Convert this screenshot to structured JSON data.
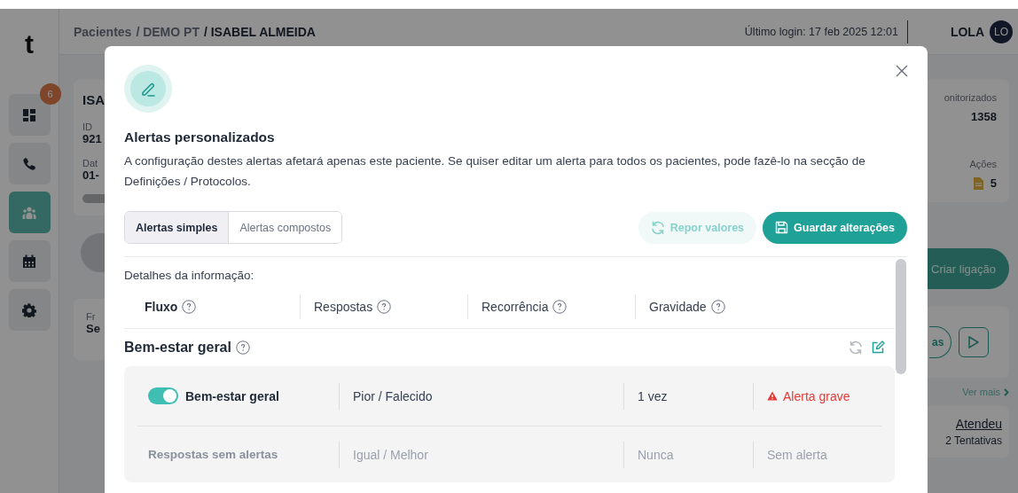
{
  "sidebar": {
    "logo": "t",
    "items": [
      {
        "kind": "dashboard",
        "badge": "6",
        "selected": false
      },
      {
        "kind": "phone",
        "selected": false
      },
      {
        "kind": "people",
        "selected": true
      },
      {
        "kind": "calendar",
        "selected": false
      },
      {
        "kind": "gear",
        "selected": false
      }
    ]
  },
  "header": {
    "breadcrumb": [
      {
        "label": "Pacientes",
        "current": false
      },
      {
        "label": "/ DEMO PT",
        "current": false
      },
      {
        "label": "/ ISABEL ALMEIDA",
        "current": true
      }
    ],
    "last_login": "Último login: 17 feb 2025 12:01",
    "user": "LOLA",
    "avatar": "LO"
  },
  "background": {
    "patient_card": {
      "name": "ISA",
      "fields": [
        {
          "label": "ID",
          "value": "921"
        },
        {
          "label": "Dat",
          "value": "01-"
        }
      ]
    },
    "frequency_card": {
      "label": "Fr",
      "value": "Se"
    },
    "stats_card": {
      "monitored_label": "onitorizados",
      "monitored_value": "1358",
      "actions_label": "Ações",
      "actions_value": "5"
    },
    "create_call_button": "Criar ligação",
    "call_card_button": "as",
    "see_more": "Ver mais",
    "call_result": {
      "status": "Atendeu",
      "attempts": "2 Tentativas"
    }
  },
  "modal": {
    "title": "Alertas personalizados",
    "description": "A configuração destes alertas afetará apenas este paciente. Se quiser editar um alerta para todos os pacientes, pode fazê-lo na secção de Definições / Protocolos.",
    "tabs": [
      {
        "label": "Alertas simples",
        "selected": true
      },
      {
        "label": "Alertas compostos",
        "selected": false
      }
    ],
    "reset_button": {
      "label": "Repor valores",
      "disabled": true
    },
    "save_button": "Guardar alterações",
    "details_label": "Detalhes da informação:",
    "columns": [
      {
        "label": "Fluxo",
        "emphasized": true
      },
      {
        "label": "Respostas",
        "emphasized": false
      },
      {
        "label": "Recorrência",
        "emphasized": false
      },
      {
        "label": "Gravidade",
        "emphasized": false
      }
    ],
    "sections": [
      {
        "title": "Bem-estar geral",
        "rows": [
          {
            "kind": "alert",
            "enabled": true,
            "label": "Bem-estar geral",
            "responses": "Pior / Falecido",
            "recurrence": "1 vez",
            "severity": "Alerta grave",
            "severe": true
          },
          {
            "kind": "no_alert",
            "label": "Respostas sem alertas",
            "responses": "Igual / Melhor",
            "recurrence": "Nunca",
            "severity": "Sem alerta",
            "severe": false
          }
        ]
      }
    ]
  }
}
